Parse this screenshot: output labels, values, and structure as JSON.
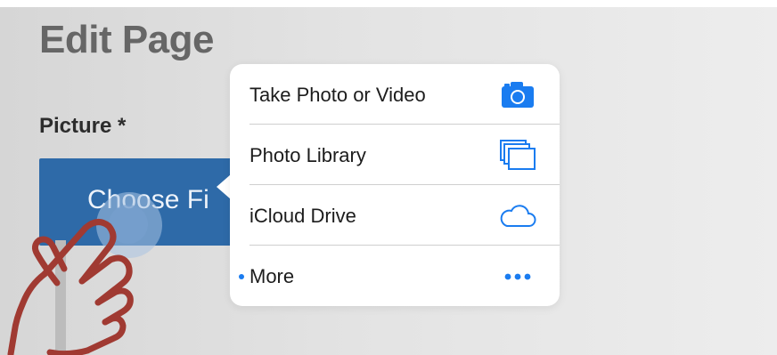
{
  "page": {
    "title": "Edit Page",
    "picture_label": "Picture *",
    "choose_button": "Choose Fi"
  },
  "popover": {
    "items": [
      {
        "label": "Take Photo or Video",
        "icon": "camera-icon"
      },
      {
        "label": "Photo Library",
        "icon": "photo-library-icon"
      },
      {
        "label": "iCloud Drive",
        "icon": "cloud-icon"
      },
      {
        "label": "More",
        "icon": "ellipsis-icon"
      }
    ]
  },
  "colors": {
    "accent": "#1a7cf0",
    "button": "#2e6aa8",
    "hand_outline": "#a03a32"
  }
}
